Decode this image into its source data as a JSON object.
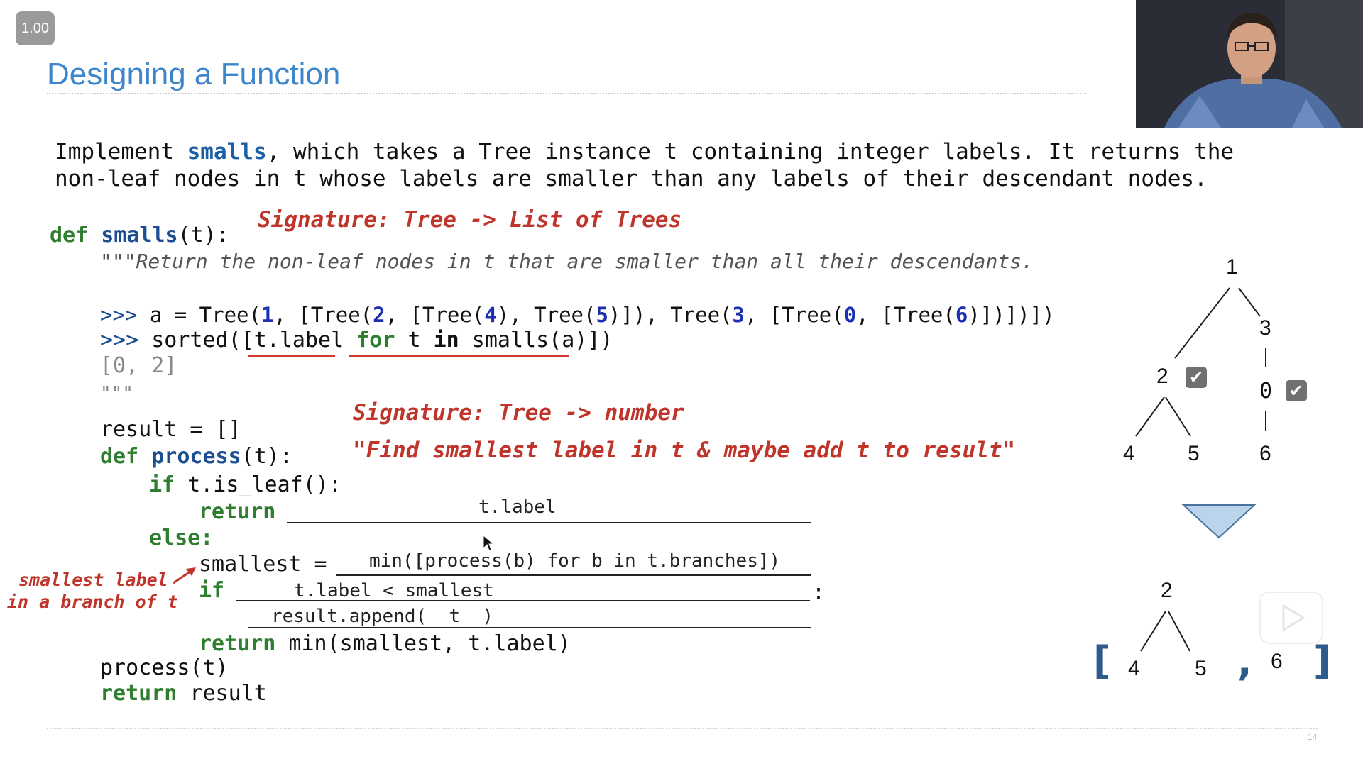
{
  "player": {
    "speed": "1.00"
  },
  "slide": {
    "title": "Designing a Function",
    "page_number": "14",
    "problem": {
      "p1": "Implement ",
      "fn": "smalls",
      "p2": ", which takes a Tree instance t containing integer labels. It returns the",
      "line2": "non-leaf nodes in t whose labels are smaller than any labels of their descendant nodes."
    },
    "annotations": {
      "sig1": "Signature: Tree -> List of Trees",
      "sig2": "Signature: Tree -> number",
      "purpose": "\"Find smallest label in t & maybe add t to result\"",
      "side_note_1": "smallest label",
      "side_note_2": "in a branch of t"
    },
    "code": {
      "def_kw": "def",
      "fn_name": "smalls",
      "fn_args": "(t):",
      "docstring": "\"\"\"Return the non-leaf nodes in t that are smaller than all their descendants.",
      "doctest1_prompt": ">>> ",
      "doctest1_pre": "a = Tree(",
      "n1": "1",
      "d1b": ", [Tree(",
      "n2": "2",
      "d1c": ", [Tree(",
      "n4": "4",
      "d1d": "), Tree(",
      "n5": "5",
      "d1e": ")]), Tree(",
      "n3": "3",
      "d1f": ", [Tree(",
      "n0": "0",
      "d1g": ", [Tree(",
      "n6": "6",
      "d1h": ")])])])",
      "doctest2_prompt": ">>> ",
      "doctest2_a": "sorted([t.label ",
      "doctest2_for": "for",
      "doctest2_b": " t ",
      "doctest2_in": "in",
      "doctest2_c": " smalls(a)])",
      "doctest_output": "[0, 2]",
      "doc_close": "\"\"\"",
      "result_init": "result = []",
      "def2_kw": "def",
      "process_name": "process",
      "process_args": "(t):",
      "if_kw": "if",
      "if_leaf_rest": " t.is_leaf():",
      "return_kw": "return",
      "else_kw": "else:",
      "smallest_assign": "smallest =",
      "if2_kw": "if",
      "colon": ":",
      "return2_kw": "return",
      "return2_rest": " min(smallest, t.label)",
      "call_process": "process(t)",
      "return3_kw": "return",
      "return3_rest": " result"
    },
    "blanks": {
      "b1": "t.label",
      "b2": "min([process(b) for b in t.branches])",
      "b3": "t.label < smallest",
      "b4": "result.append(  t  )"
    },
    "tree_top": {
      "root": "1",
      "left": "2",
      "right": "3",
      "left_left": "4",
      "left_right": "5",
      "right_child": "0",
      "right_grandchild": "6"
    },
    "tree_result": {
      "root": "2",
      "left": "4",
      "right": "5",
      "single": "6",
      "open_bracket": "[",
      "comma": ",",
      "close_bracket": "]"
    },
    "colors": {
      "title": "#3d86cc",
      "keyword": "#2f7d2f",
      "function": "#1b4f91",
      "annotation": "#c0352b",
      "triangle": "#bcd3ec"
    }
  }
}
